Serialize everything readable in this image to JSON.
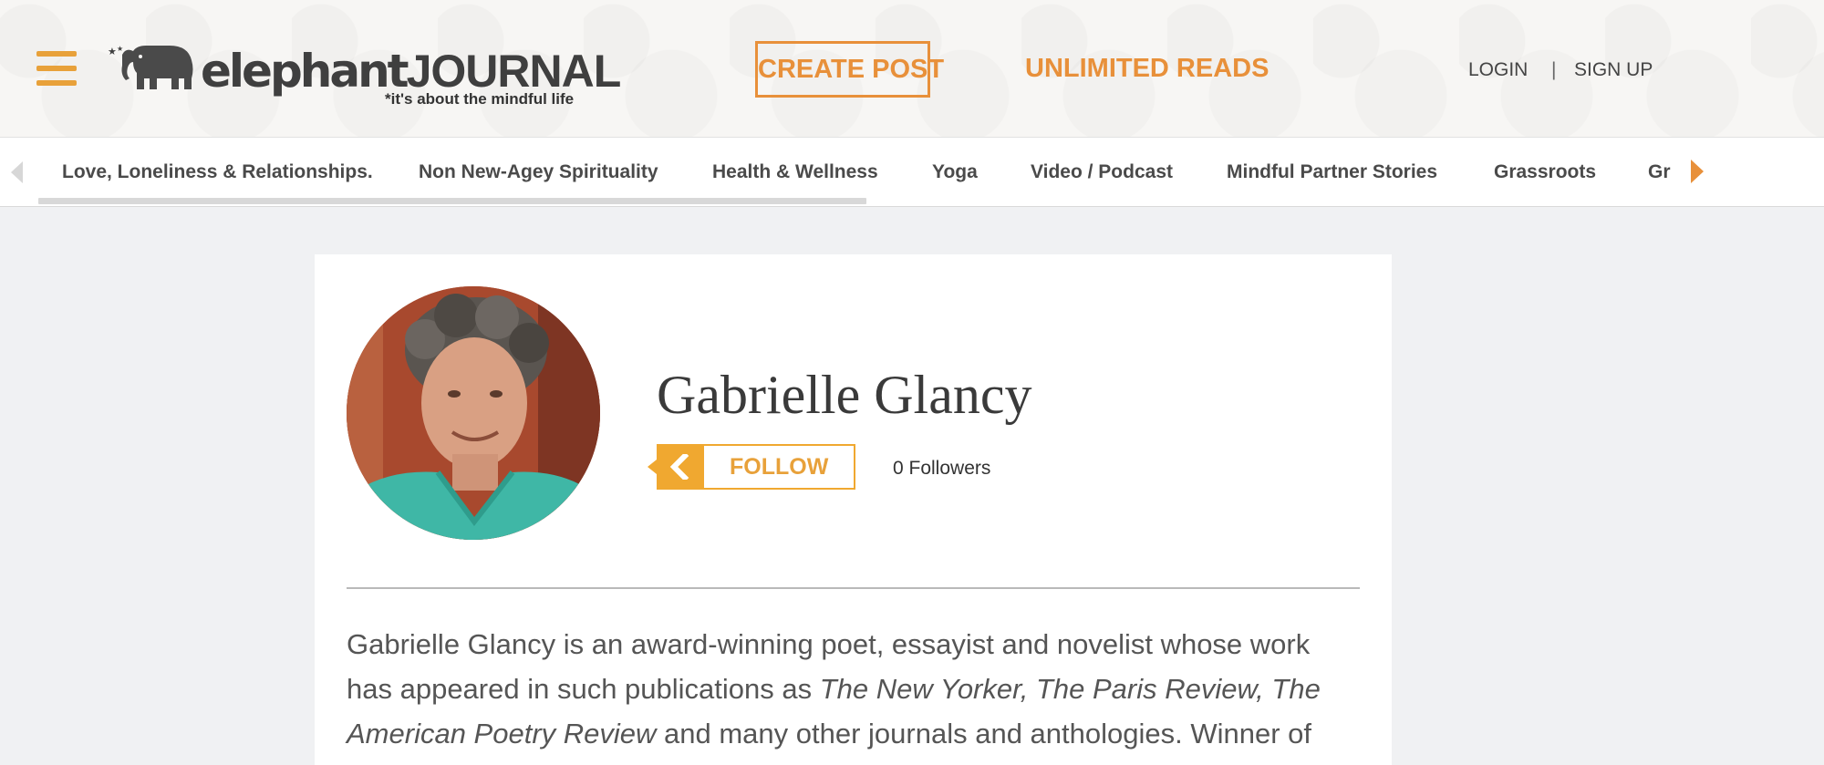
{
  "header": {
    "logo": {
      "wordmark_light": "elephant",
      "wordmark_bold": "JOURNAL",
      "tagline": "*it's about the mindful life"
    },
    "create_post": "CREATE POST",
    "unlimited_reads": "UNLIMITED READS",
    "login": "LOGIN",
    "separator": "|",
    "signup": "SIGN UP",
    "accent_color": "#e8903a",
    "menu_color": "#e8a13a"
  },
  "categories": {
    "items": [
      "Love, Loneliness & Relationships.",
      "Non New-Agey Spirituality",
      "Health & Wellness",
      "Yoga",
      "Video / Podcast",
      "Mindful Partner Stories",
      "Grassroots",
      "Gr"
    ]
  },
  "profile": {
    "name": "Gabrielle Glancy",
    "follow_label": "FOLLOW",
    "followers_text": "0 Followers",
    "bio_parts": [
      "Gabrielle Glancy is an award-winning poet, essayist and novelist whose work has appeared in such publications as ",
      "The New Yorker, The Paris Review, The American Poetry Review",
      " and many other journals and anthologies.  Winner of"
    ]
  },
  "icons": {
    "menu": "hamburger-icon",
    "logo": "elephant-icon",
    "nav_left": "chevron-left-icon",
    "nav_right": "chevron-right-icon",
    "follow": "chevron-left-icon"
  }
}
